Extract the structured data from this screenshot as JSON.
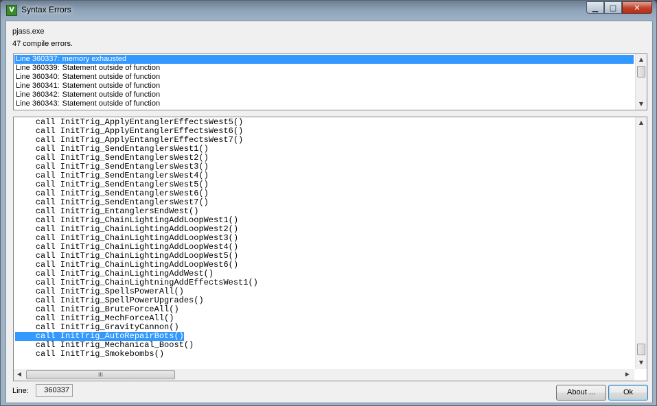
{
  "window": {
    "title": "Syntax Errors",
    "icon": "app-icon"
  },
  "caption_buttons": {
    "minimize": "▁",
    "maximize": "□",
    "close": "✕"
  },
  "header": {
    "program": "pjass.exe",
    "summary": "47 compile errors."
  },
  "errors": [
    {
      "line": "Line 360337:",
      "message": "memory exhausted",
      "selected": true
    },
    {
      "line": "Line 360339:",
      "message": "Statement outside of function"
    },
    {
      "line": "Line 360340:",
      "message": "Statement outside of function"
    },
    {
      "line": "Line 360341:",
      "message": "Statement outside of function"
    },
    {
      "line": "Line 360342:",
      "message": "Statement outside of function"
    },
    {
      "line": "Line 360343:",
      "message": "Statement outside of function"
    }
  ],
  "code_lines": [
    "    call InitTrig_ApplyEntanglerEffectsWest5()",
    "    call InitTrig_ApplyEntanglerEffectsWest6()",
    "    call InitTrig_ApplyEntanglerEffectsWest7()",
    "    call InitTrig_SendEntanglersWest1()",
    "    call InitTrig_SendEntanglersWest2()",
    "    call InitTrig_SendEntanglersWest3()",
    "    call InitTrig_SendEntanglersWest4()",
    "    call InitTrig_SendEntanglersWest5()",
    "    call InitTrig_SendEntanglersWest6()",
    "    call InitTrig_SendEntanglersWest7()",
    "    call InitTrig_EntanglersEndWest()",
    "    call InitTrig_ChainLightingAddLoopWest1()",
    "    call InitTrig_ChainLightingAddLoopWest2()",
    "    call InitTrig_ChainLightingAddLoopWest3()",
    "    call InitTrig_ChainLightingAddLoopWest4()",
    "    call InitTrig_ChainLightingAddLoopWest5()",
    "    call InitTrig_ChainLightingAddLoopWest6()",
    "    call InitTrig_ChainLightingAddWest()",
    "    call InitTrig_ChainLightningAddEffectsWest1()",
    "    call InitTrig_SpellsPowerAll()",
    "    call InitTrig_SpellPowerUpgrades()",
    "    call InitTrig_BruteForceAll()",
    "    call InitTrig_MechForceAll()",
    "    call InitTrig_GravityCannon()",
    "    call InitTrig_AutoRepairBots()",
    "    call InitTrig_Mechanical_Boost()",
    "    call InitTrig_Smokebombs()"
  ],
  "selected_code_index": 24,
  "footer": {
    "line_label": "Line:",
    "line_value": "360337",
    "about_label": "About ...",
    "ok_label": "Ok"
  },
  "scroll": {
    "up": "▲",
    "down": "▼",
    "left": "◀",
    "right": "▶",
    "grip": "III"
  },
  "colors": {
    "selection": "#3399ff",
    "title_glow": "#e8f0f8",
    "close_button": "#c0402a"
  }
}
